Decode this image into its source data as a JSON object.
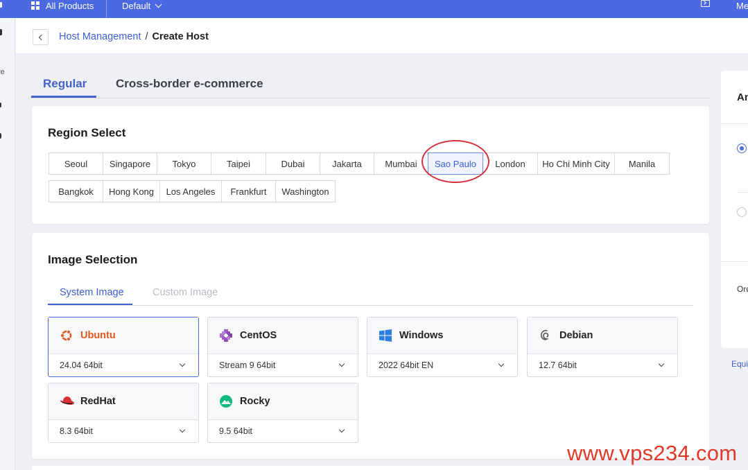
{
  "topbar": {
    "all_products": "All Products",
    "workspace": "Default",
    "right_label": "Me"
  },
  "sidebar": {
    "partial_text": "re"
  },
  "breadcrumb": {
    "parent": "Host Management",
    "separator": "/",
    "current": "Create Host"
  },
  "tabs": {
    "regular": "Regular",
    "cross_border": "Cross-border e-commerce"
  },
  "region": {
    "title": "Region Select",
    "selected": "Sao Paulo",
    "row1": [
      "Seoul",
      "Singapore",
      "Tokyo",
      "Taipei",
      "Dubai",
      "Jakarta",
      "Mumbai",
      "Sao Paulo",
      "London",
      "Ho Chi Minh City",
      "Manila"
    ],
    "row2": [
      "Bangkok",
      "Hong Kong",
      "Los Angeles",
      "Frankfurt",
      "Washington"
    ]
  },
  "image": {
    "title": "Image Selection",
    "tab_system": "System Image",
    "tab_custom": "Custom Image",
    "os": [
      {
        "name": "Ubuntu",
        "version": "24.04 64bit",
        "icon": "ubuntu-icon",
        "selected": true
      },
      {
        "name": "CentOS",
        "version": "Stream 9 64bit",
        "icon": "centos-icon",
        "selected": false
      },
      {
        "name": "Windows",
        "version": "2022 64bit EN",
        "icon": "windows-icon",
        "selected": false
      },
      {
        "name": "Debian",
        "version": "12.7 64bit",
        "icon": "debian-icon",
        "selected": false
      },
      {
        "name": "RedHat",
        "version": "8.3 64bit",
        "icon": "redhat-icon",
        "selected": false
      },
      {
        "name": "Rocky",
        "version": "9.5 64bit",
        "icon": "rocky-icon",
        "selected": false
      }
    ]
  },
  "right_panel": {
    "header": "An",
    "order_label": "Ord",
    "link": "Equi"
  },
  "watermark": "www.vps234.com",
  "colors": {
    "brand": "#4a69e2",
    "accent": "#3d5fd6",
    "highlight_circle": "#d8303a",
    "ubuntu_orange": "#e05a20"
  }
}
